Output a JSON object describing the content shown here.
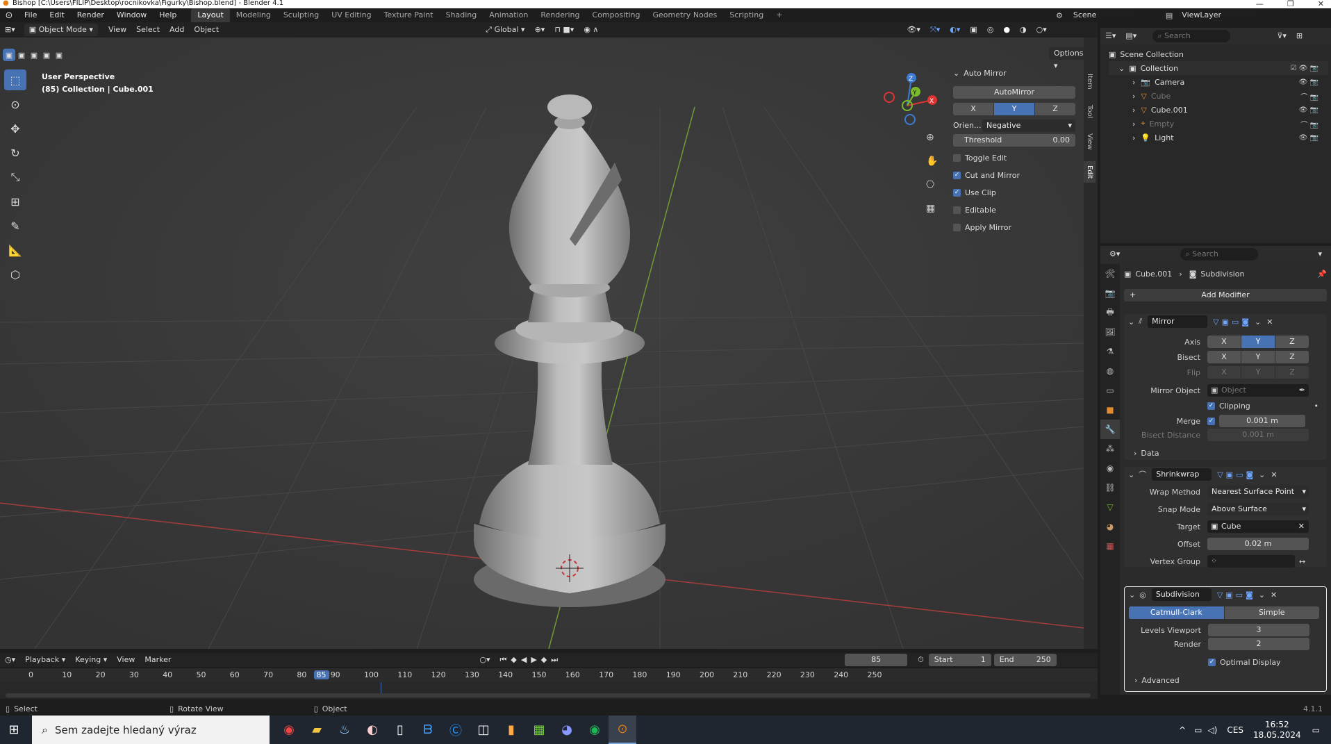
{
  "window": {
    "title": "Bishop [C:\\Users\\FILIP\\Desktop\\rocnikovka\\Figurky\\Bishop.blend] - Blender 4.1",
    "controls": [
      "—",
      "❐",
      "✕"
    ]
  },
  "menu": [
    "File",
    "Edit",
    "Render",
    "Window",
    "Help"
  ],
  "workspaces": [
    "Layout",
    "Modeling",
    "Sculpting",
    "UV Editing",
    "Texture Paint",
    "Shading",
    "Animation",
    "Rendering",
    "Compositing",
    "Geometry Nodes",
    "Scripting"
  ],
  "workspace_active": "Layout",
  "scene": {
    "label": "Scene",
    "viewlayer": "ViewLayer"
  },
  "header": {
    "mode": "Object Mode",
    "menus": [
      "View",
      "Select",
      "Add",
      "Object"
    ],
    "orientation": "Global",
    "options": "Options"
  },
  "viewport": {
    "perspective": "User Perspective",
    "collection": "(85) Collection | Cube.001",
    "gizmo_axes": [
      "Z",
      "Y",
      "X"
    ]
  },
  "npanel": {
    "title": "Auto Mirror",
    "button": "AutoMirror",
    "axes": [
      "X",
      "Y",
      "Z"
    ],
    "axis_active": "Y",
    "orientation_label": "Orien...",
    "orientation_value": "Negative",
    "threshold_label": "Threshold",
    "threshold_value": "0.00",
    "toggles": [
      {
        "label": "Toggle Edit",
        "checked": false
      },
      {
        "label": "Cut and Mirror",
        "checked": true
      },
      {
        "label": "Use Clip",
        "checked": true
      },
      {
        "label": "Editable",
        "checked": false
      },
      {
        "label": "Apply Mirror",
        "checked": false
      }
    ],
    "tabs": [
      "Item",
      "Tool",
      "View",
      "Edit"
    ]
  },
  "outliner": {
    "search_placeholder": "Search",
    "root": "Scene Collection",
    "collection": "Collection",
    "items": [
      {
        "name": "Camera",
        "dim": false
      },
      {
        "name": "Cube",
        "dim": true
      },
      {
        "name": "Cube.001",
        "dim": false
      },
      {
        "name": "Empty",
        "dim": true
      },
      {
        "name": "Light",
        "dim": false
      }
    ]
  },
  "properties": {
    "search_placeholder": "Search",
    "breadcrumb_object": "Cube.001",
    "breadcrumb_modifier": "Subdivision",
    "add_modifier": "Add Modifier",
    "mirror": {
      "name": "Mirror",
      "axis_label": "Axis",
      "bisect_label": "Bisect",
      "flip_label": "Flip",
      "axes": [
        "X",
        "Y",
        "Z"
      ],
      "mirror_object_label": "Mirror Object",
      "mirror_object_placeholder": "Object",
      "clipping_label": "Clipping",
      "merge_label": "Merge",
      "merge_value": "0.001 m",
      "bisect_distance_label": "Bisect Distance",
      "bisect_distance_value": "0.001 m",
      "data_label": "Data"
    },
    "shrinkwrap": {
      "name": "Shrinkwrap",
      "wrap_method_label": "Wrap Method",
      "wrap_method_value": "Nearest Surface Point",
      "snap_mode_label": "Snap Mode",
      "snap_mode_value": "Above Surface",
      "target_label": "Target",
      "target_value": "Cube",
      "offset_label": "Offset",
      "offset_value": "0.02 m",
      "vertex_group_label": "Vertex Group"
    },
    "subdivision": {
      "name": "Subdivision",
      "types": [
        "Catmull-Clark",
        "Simple"
      ],
      "levels_viewport_label": "Levels Viewport",
      "levels_viewport_value": "3",
      "render_label": "Render",
      "render_value": "2",
      "optimal_display_label": "Optimal Display",
      "advanced_label": "Advanced"
    }
  },
  "timeline": {
    "menus": [
      "Playback",
      "Keying",
      "View",
      "Marker"
    ],
    "current_frame": "85",
    "start_label": "Start",
    "start_value": "1",
    "end_label": "End",
    "end_value": "250",
    "ticks": [
      "0",
      "10",
      "20",
      "30",
      "40",
      "50",
      "60",
      "70",
      "80",
      "85",
      "90",
      "100",
      "110",
      "120",
      "130",
      "140",
      "150",
      "160",
      "170",
      "180",
      "190",
      "200",
      "210",
      "220",
      "230",
      "240",
      "250"
    ]
  },
  "statusbar": {
    "select": "Select",
    "rotate": "Rotate View",
    "object": "Object",
    "version": "4.1.1"
  },
  "taskbar": {
    "search_placeholder": "Sem zadejte hledaný výraz",
    "time": "16:52",
    "date": "18.05.2024",
    "language": "CES"
  },
  "colors": {
    "accent": "#4772b3",
    "viewport_bg": "#3b3b3b",
    "x_axis": "#a63c3c",
    "y_axis": "#6f9a35"
  }
}
